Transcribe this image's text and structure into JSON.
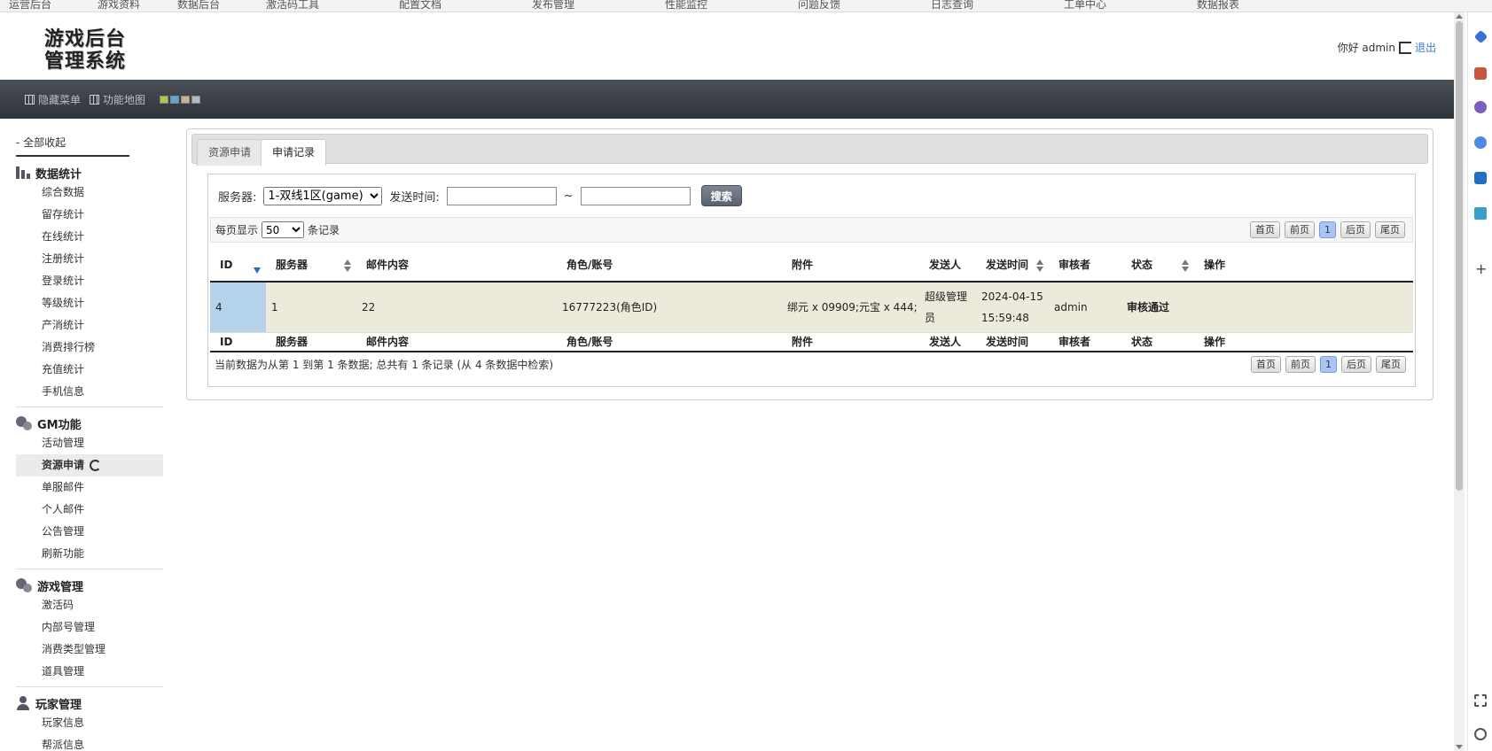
{
  "bookmarks": [
    "运营后台",
    "游戏资料",
    "数据后台",
    "激活码工具",
    "配置文档",
    "发布管理",
    "性能监控",
    "问题反馈",
    "日志查询",
    "工单中心",
    "数据报表"
  ],
  "header": {
    "logo_line1": "游戏后台",
    "logo_line2": "管理系统",
    "greeting": "你好 admin",
    "logout": "退出"
  },
  "navbar": {
    "hide_menu": "隐藏菜单",
    "function_map": "功能地图",
    "theme_colors": [
      "#a8c84a",
      "#5aa9d6",
      "#c8b48a",
      "#b0b8c4"
    ]
  },
  "sidebar": {
    "collapse_all": "- 全部收起",
    "groups": [
      {
        "title": "数据统计",
        "items": [
          "综合数据",
          "留存统计",
          "在线统计",
          "注册统计",
          "登录统计",
          "等级统计",
          "产消统计",
          "消费排行榜",
          "充值统计",
          "手机信息"
        ]
      },
      {
        "title": "GM功能",
        "items": [
          "活动管理",
          "资源申请",
          "单服邮件",
          "个人邮件",
          "公告管理",
          "刷新功能"
        ]
      },
      {
        "title": "游戏管理",
        "items": [
          "激活码",
          "内部号管理",
          "消费类型管理",
          "道具管理"
        ]
      },
      {
        "title": "玩家管理",
        "items": [
          "玩家信息",
          "帮派信息"
        ]
      }
    ]
  },
  "tabs": [
    "资源申请",
    "申请记录"
  ],
  "search": {
    "server_label": "服务器:",
    "server_value": "1-双线1区(game)",
    "time_label": "发送时间:",
    "tilde": "~",
    "button": "搜索"
  },
  "list": {
    "per_page_prefix": "每页显示",
    "per_page_value": "50",
    "per_page_suffix": "条记录",
    "pager": {
      "first": "首页",
      "prev": "前页",
      "current": "1",
      "next": "后页",
      "last": "尾页"
    },
    "columns": [
      "ID",
      "服务器",
      "邮件内容",
      "角色/账号",
      "附件",
      "发送人",
      "发送时间",
      "审核者",
      "状态",
      "操作"
    ],
    "rows": [
      {
        "id": "4",
        "server": "1",
        "mail": "22",
        "role": "16777223(角色ID)",
        "attachment": "绑元 x 09909;元宝 x 444;",
        "sender": "超级管理员",
        "time": "2024-04-15 15:59:48",
        "reviewer": "admin",
        "status": "审核通过",
        "action": ""
      }
    ],
    "footer": "当前数据为从第 1 到第 1 条数据; 总共有 1 条记录 (从 4 条数据中检索)"
  }
}
